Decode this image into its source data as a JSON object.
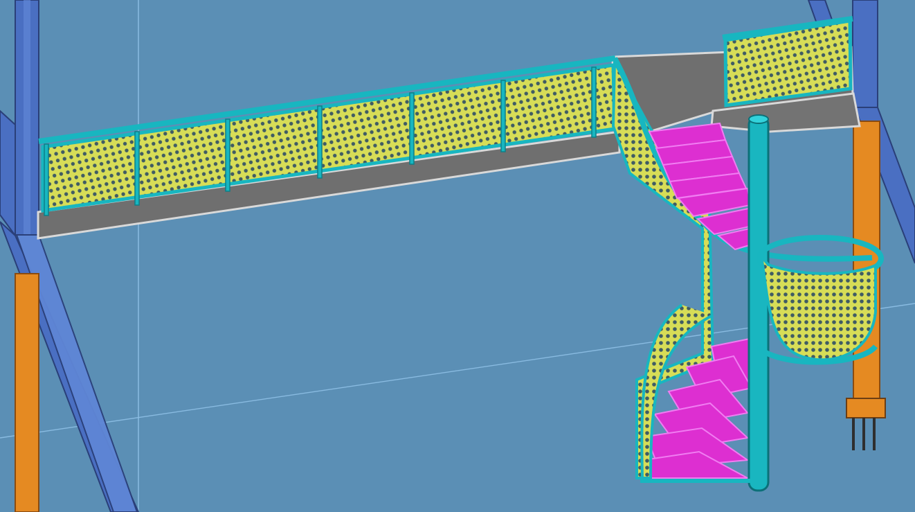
{
  "viewport": {
    "background_color": "#5b8fb5",
    "view": "3d-model-viewport"
  },
  "model": {
    "objects": [
      "steel-column",
      "bracing-member",
      "orange-column",
      "grid-line",
      "walkway-deck",
      "perforated-guardrail-panel",
      "handrail",
      "spiral-stair-treads",
      "stair-center-post",
      "landing-guard",
      "column-base-plate"
    ],
    "colors": {
      "steel_column": "#4a6fc2",
      "bracing_member": "#4a6fc2",
      "orange_column": "#e58a22",
      "walkway_deck": "#6f6f6f",
      "deck_edge": "#d9d9d9",
      "guardrail_panel": "#d7dd57",
      "perforation": "#405c64",
      "handrail": "#18b6c0",
      "stair_tread": "#dd2fd1",
      "stair_tread_edge": "#f07df1",
      "center_post": "#19b6c0",
      "grid_line": "#8fc0e6"
    }
  }
}
